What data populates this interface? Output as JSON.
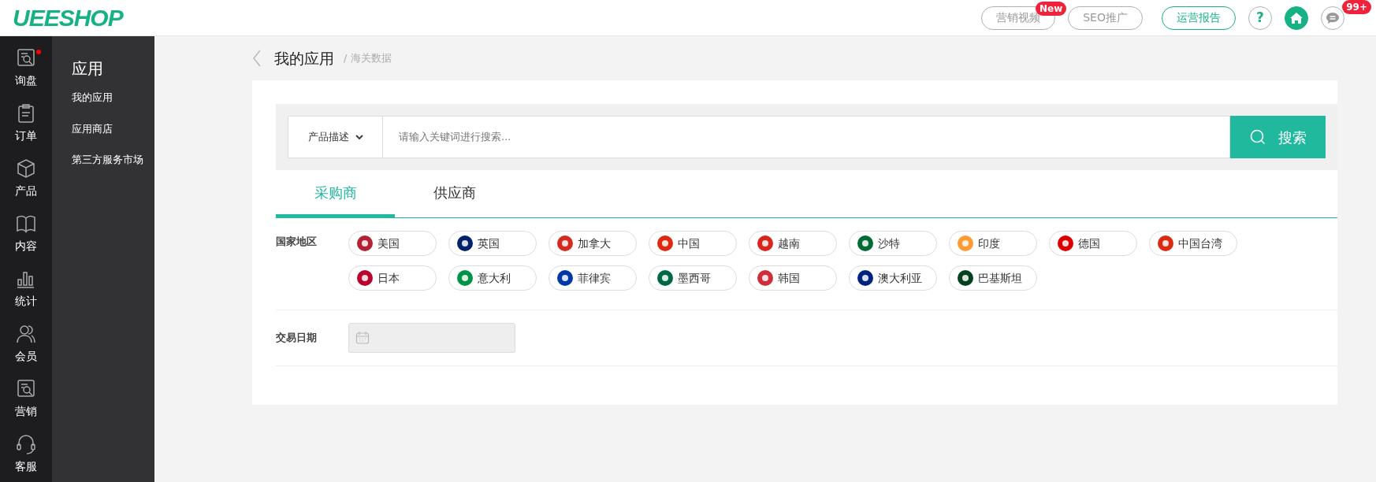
{
  "logo": "UEESHOP",
  "header_actions": [
    {
      "kind": "pill",
      "label": "营销视频",
      "badge": "New"
    },
    {
      "kind": "pill",
      "label": "SEO推广"
    },
    {
      "kind": "accent",
      "label": "运营报告"
    },
    {
      "kind": "help",
      "label": "?"
    },
    {
      "kind": "home"
    },
    {
      "kind": "chat",
      "badge": "99+"
    }
  ],
  "nav": [
    {
      "label": "询盘",
      "unread": true
    },
    {
      "label": "订单",
      "unread": false
    },
    {
      "label": "产品",
      "unread": false
    },
    {
      "label": "内容",
      "unread": false
    },
    {
      "label": "统计",
      "unread": false
    },
    {
      "label": "会员",
      "unread": false
    },
    {
      "label": "营销",
      "unread": false
    },
    {
      "label": "客服",
      "unread": false
    }
  ],
  "submenu": {
    "title": "应用",
    "items": [
      "我的应用",
      "应用商店",
      "第三方服务市场"
    ]
  },
  "breadcrumb": {
    "title": "我的应用",
    "sub": "/ 海关数据"
  },
  "search": {
    "field_select": "产品描述",
    "placeholder": "请输入关键词进行搜索...",
    "button": "搜索"
  },
  "tabs": [
    {
      "label": "采购商",
      "selected": true
    },
    {
      "label": "供应商",
      "selected": false
    }
  ],
  "filters": {
    "country_label": "国家地区",
    "countries": [
      {
        "label": "美国",
        "color": "#b22234"
      },
      {
        "label": "英国",
        "color": "#012169"
      },
      {
        "label": "加拿大",
        "color": "#d52b1e"
      },
      {
        "label": "中国",
        "color": "#de2910"
      },
      {
        "label": "越南",
        "color": "#da251d"
      },
      {
        "label": "沙特",
        "color": "#006c35"
      },
      {
        "label": "印度",
        "color": "#ff9933"
      },
      {
        "label": "德国",
        "color": "#dd0000"
      },
      {
        "label": "中国台湾",
        "color": "#de2910"
      },
      {
        "label": "日本",
        "color": "#bc002d"
      },
      {
        "label": "意大利",
        "color": "#009246"
      },
      {
        "label": "菲律宾",
        "color": "#0038a8"
      },
      {
        "label": "墨西哥",
        "color": "#006847"
      },
      {
        "label": "韩国",
        "color": "#cd2e3a"
      },
      {
        "label": "澳大利亚",
        "color": "#00247d"
      },
      {
        "label": "巴基斯坦",
        "color": "#01411c"
      }
    ],
    "date_label": "交易日期",
    "date_disabled": true
  }
}
